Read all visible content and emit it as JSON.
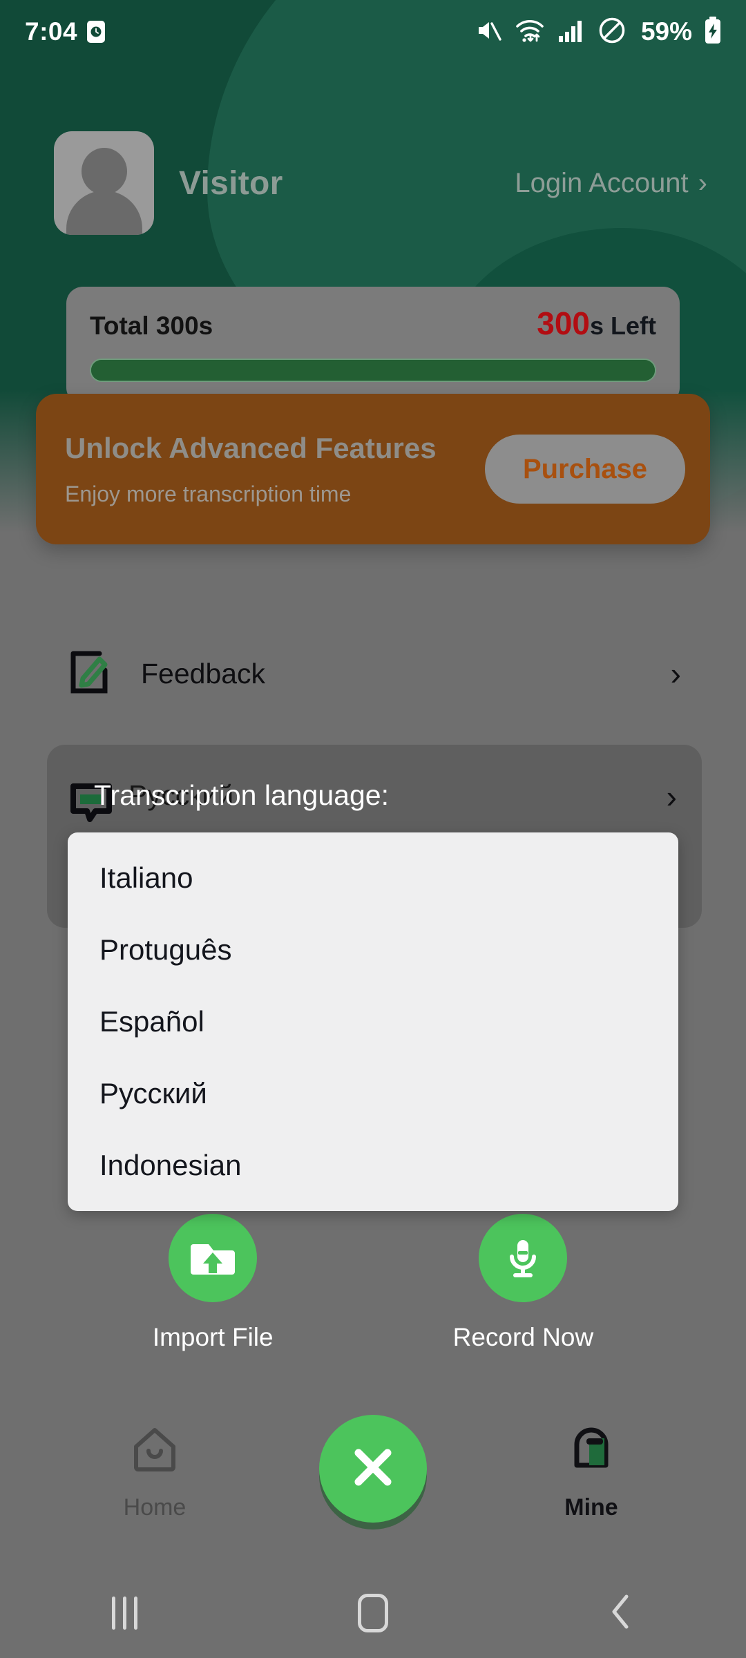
{
  "status_bar": {
    "time": "7:04",
    "battery_percent": "59%",
    "icons": [
      "clock-icon",
      "mute-icon",
      "wifi-icon",
      "signal-icon",
      "do-not-disturb-icon",
      "battery-charging-icon"
    ]
  },
  "header": {
    "user_name": "Visitor",
    "login_label": "Login Account",
    "login_chevron": "›",
    "avatar_icon": "person-placeholder-icon",
    "background_color": "#114a38"
  },
  "time_card": {
    "total_label": "Total 300s",
    "remaining_number": "300",
    "remaining_suffix": "s Left",
    "progress_percent": 100,
    "progress_color": "#235f33",
    "remaining_color": "#b20d12"
  },
  "banner": {
    "title": "Unlock Advanced Features",
    "subtitle": "Enjoy more transcription time",
    "button_label": "Purchase",
    "background_color": "#7c4514",
    "button_text_color": "#a8500f"
  },
  "feedback": {
    "label": "Feedback",
    "icon": "edit-note-icon",
    "chevron": "›"
  },
  "language_row": {
    "label": "Transcription language:",
    "current_value": "Русский",
    "icon": "speech-bubble-icon",
    "chevron": "›"
  },
  "language_dropdown": {
    "options": [
      {
        "label": "Italiano"
      },
      {
        "label": "Protuguês"
      },
      {
        "label": "Español"
      },
      {
        "label": "Русский"
      },
      {
        "label": "Indonesian"
      }
    ]
  },
  "actions": [
    {
      "label": "Import File",
      "icon": "folder-upload-icon"
    },
    {
      "label": "Record Now",
      "icon": "microphone-icon"
    }
  ],
  "bottom_nav": {
    "home": {
      "label": "Home",
      "icon": "home-icon",
      "active": false
    },
    "mine": {
      "label": "Mine",
      "icon": "profile-bag-icon",
      "active": true
    },
    "fab": {
      "icon": "close-x-icon",
      "color": "#4cc45c"
    }
  },
  "system_nav": {
    "recents": "recents-icon",
    "home": "home-square-icon",
    "back": "back-chevron-icon"
  }
}
